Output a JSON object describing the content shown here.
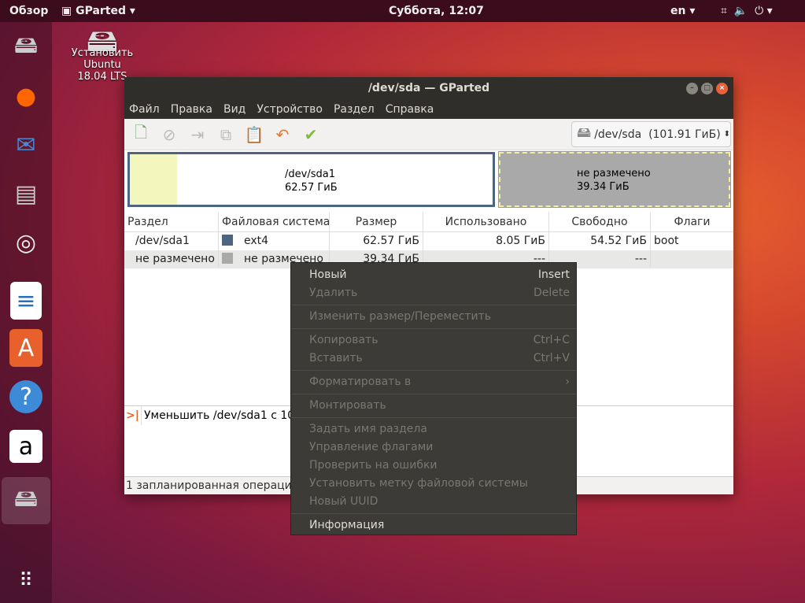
{
  "topbar": {
    "activities": "Обзор",
    "app": "GParted",
    "clock": "Суббота, 12:07",
    "lang": "en"
  },
  "desktop": {
    "installer_label": "Установить Ubuntu 18.04 LTS"
  },
  "dock": [
    "installer",
    "firefox",
    "thunderbird",
    "files",
    "rhythmbox",
    "writer",
    "software",
    "help",
    "amazon",
    "gparted",
    "apps"
  ],
  "window": {
    "title": "/dev/sda — GParted",
    "menu": [
      "Файл",
      "Правка",
      "Вид",
      "Устройство",
      "Раздел",
      "Справка"
    ],
    "device": "/dev/sda  (101.91 ГиБ)",
    "graph": [
      {
        "name": "/dev/sda1",
        "size": "62.57 ГиБ"
      },
      {
        "name": "не размечено",
        "size": "39.34 ГиБ"
      }
    ],
    "columns": [
      "Раздел",
      "Файловая система",
      "Размер",
      "Использовано",
      "Свободно",
      "Флаги"
    ],
    "rows": [
      {
        "partition": "/dev/sda1",
        "fs": "ext4",
        "size": "62.57 ГиБ",
        "used": "8.05 ГиБ",
        "free": "54.52 ГиБ",
        "flags": "boot",
        "color": "#4d6580"
      },
      {
        "partition": "не размечено",
        "fs": "не размечено",
        "size": "39.34 ГиБ",
        "used": "---",
        "free": "---",
        "flags": "",
        "color": "#a9a9a9"
      }
    ],
    "log": "Уменьшить /dev/sda1 с 101",
    "status": "1 запланированная операция"
  },
  "context_menu": [
    {
      "label": "Новый",
      "shortcut": "Insert",
      "enabled": true
    },
    {
      "label": "Удалить",
      "shortcut": "Delete",
      "enabled": false
    },
    {
      "sep": true
    },
    {
      "label": "Изменить размер/Переместить",
      "shortcut": "",
      "enabled": false
    },
    {
      "sep": true
    },
    {
      "label": "Копировать",
      "shortcut": "Ctrl+C",
      "enabled": false
    },
    {
      "label": "Вставить",
      "shortcut": "Ctrl+V",
      "enabled": false
    },
    {
      "sep": true
    },
    {
      "label": "Форматировать в",
      "shortcut": "›",
      "enabled": false
    },
    {
      "sep": true
    },
    {
      "label": "Монтировать",
      "shortcut": "",
      "enabled": false
    },
    {
      "sep": true
    },
    {
      "label": "Задать имя раздела",
      "shortcut": "",
      "enabled": false
    },
    {
      "label": "Управление флагами",
      "shortcut": "",
      "enabled": false
    },
    {
      "label": "Проверить на ошибки",
      "shortcut": "",
      "enabled": false
    },
    {
      "label": "Установить метку файловой системы",
      "shortcut": "",
      "enabled": false
    },
    {
      "label": "Новый UUID",
      "shortcut": "",
      "enabled": false
    },
    {
      "sep": true
    },
    {
      "label": "Информация",
      "shortcut": "",
      "enabled": true
    }
  ]
}
